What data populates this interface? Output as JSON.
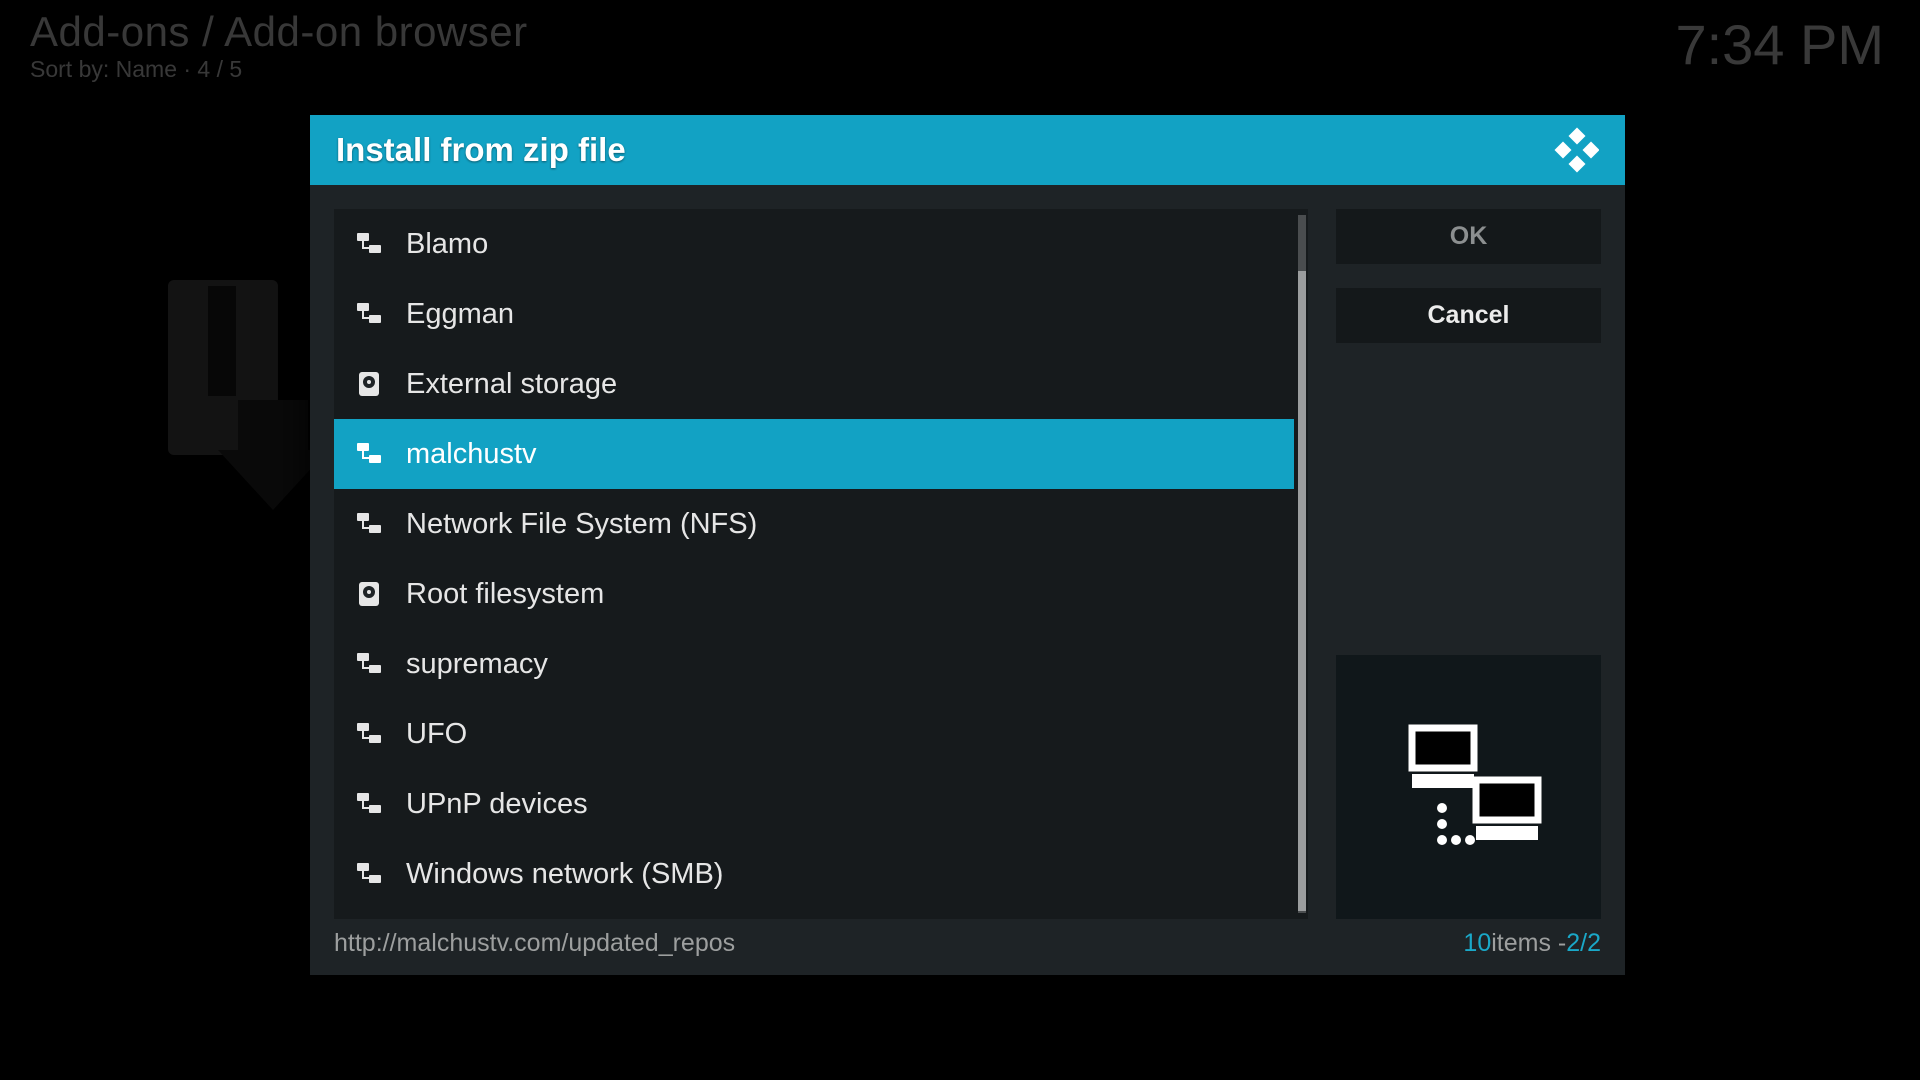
{
  "background": {
    "breadcrumb": "Add-ons / Add-on browser",
    "sort_line": "Sort by: Name  ·  4 / 5",
    "clock": "7:34 PM"
  },
  "dialog": {
    "title": "Install from zip file",
    "items": [
      {
        "label": "Blamo",
        "icon": "net"
      },
      {
        "label": "Eggman",
        "icon": "net"
      },
      {
        "label": "External storage",
        "icon": "disk"
      },
      {
        "label": "malchustv",
        "icon": "net",
        "selected": true
      },
      {
        "label": "Network File System (NFS)",
        "icon": "net"
      },
      {
        "label": "Root filesystem",
        "icon": "disk"
      },
      {
        "label": "supremacy",
        "icon": "net"
      },
      {
        "label": "UFO",
        "icon": "net"
      },
      {
        "label": "UPnP devices",
        "icon": "net"
      },
      {
        "label": "Windows network (SMB)",
        "icon": "net"
      }
    ],
    "buttons": {
      "ok": "OK",
      "cancel": "Cancel"
    },
    "footer": {
      "path": "http://malchustv.com/updated_repos",
      "count_num": "10",
      "count_word": " items - ",
      "page": "2/2"
    }
  },
  "colors": {
    "accent": "#12a2c4"
  }
}
